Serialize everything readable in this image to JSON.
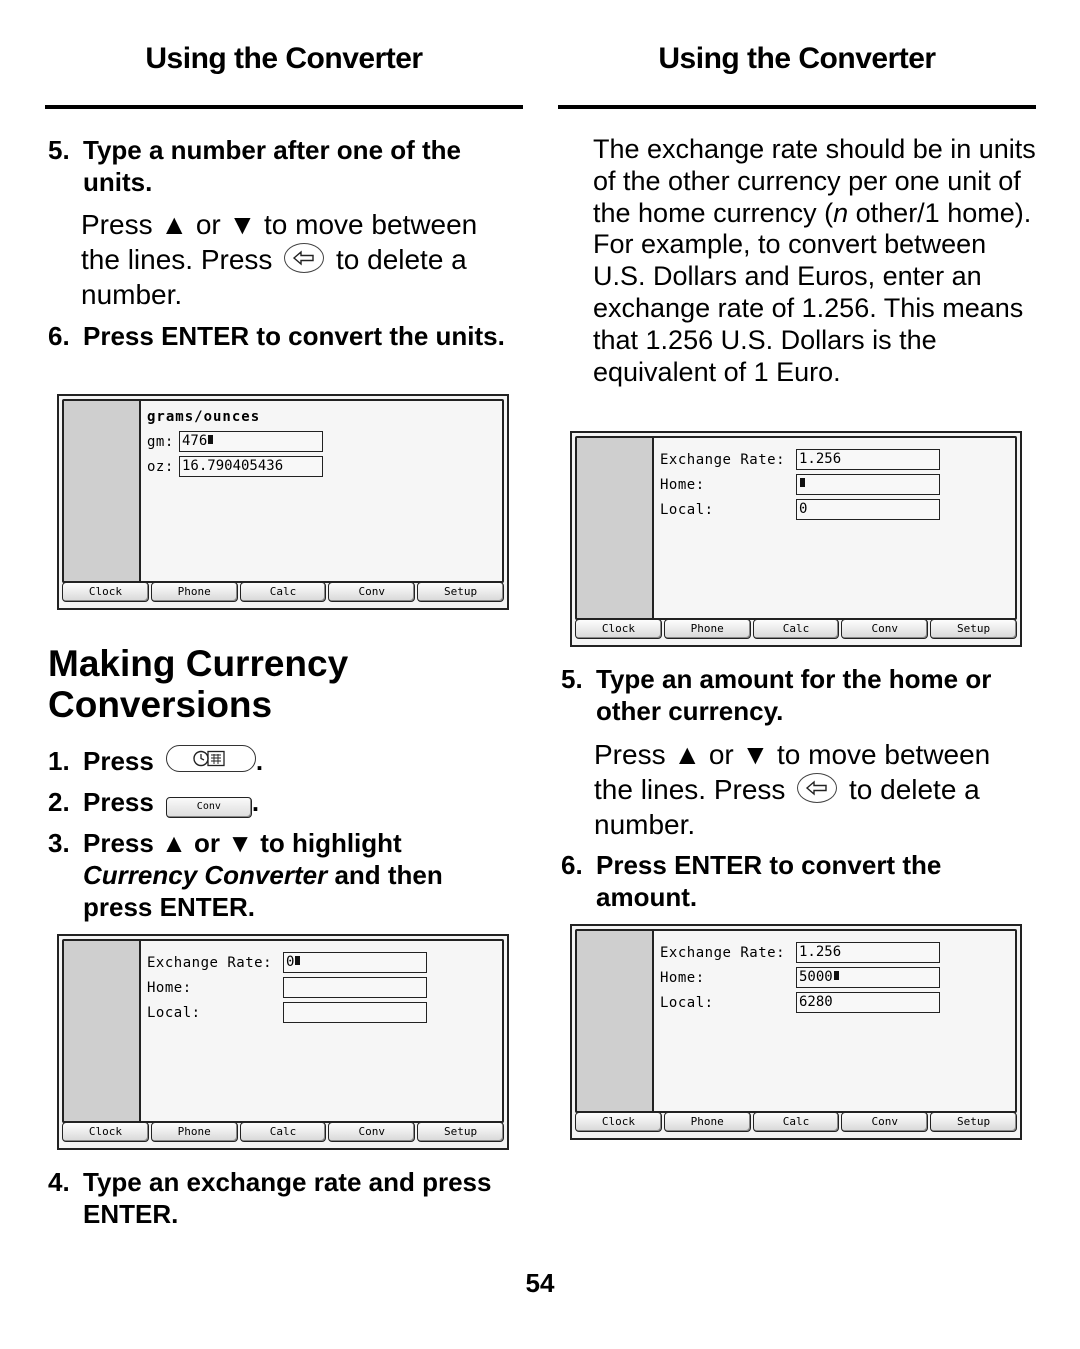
{
  "page": {
    "left_header": "Using the Converter",
    "right_header": "Using the Converter",
    "page_number": "54"
  },
  "left": {
    "step5": {
      "num": "5.",
      "text": "Type a number after one of the units."
    },
    "step5_body": {
      "a": "Press ▲ or ▼ to move between the lines. Press",
      "b": "to delete a number."
    },
    "step6": {
      "num": "6.",
      "text": "Press ENTER to convert the units."
    },
    "section_title": "Making Currency Conversions",
    "step1": {
      "num": "1.",
      "text": "Press",
      "suffix": "."
    },
    "step2": {
      "num": "2.",
      "text": "Press",
      "key_label": "Conv",
      "suffix": "."
    },
    "step3": {
      "num": "3.",
      "text_a": "Press ▲ or ▼ to highlight",
      "italic": "Currency Converter",
      "text_b": "and then press ENTER."
    },
    "step4": {
      "num": "4.",
      "text": "Type an exchange rate and press ENTER."
    }
  },
  "right": {
    "intro": {
      "a": "The exchange rate should be in units of the other currency per one unit of the home currency (",
      "italic": "n",
      "b": " other/1 home). For example, to convert between U.S. Dollars and Euros, enter an exchange rate of 1.256. This means that 1.256 U.S. Dollars is the equivalent of 1 Euro."
    },
    "step5": {
      "num": "5.",
      "text": "Type an amount for the home or other currency."
    },
    "step5_body": {
      "a": "Press ▲ or ▼ to move between the lines. Press",
      "b": "to delete a number."
    },
    "step6": {
      "num": "6.",
      "text": "Press ENTER to convert the amount."
    }
  },
  "tabs": [
    "Clock",
    "Phone",
    "Calc",
    "Conv",
    "Setup"
  ],
  "screens": {
    "units": {
      "title": "grams/ounces",
      "rows": [
        {
          "label": "gm:",
          "value": "476",
          "cursor": true
        },
        {
          "label": "oz:",
          "value": "16.790405436",
          "cursor": false
        }
      ]
    },
    "currency_empty": {
      "rows": [
        {
          "label": "Exchange Rate:",
          "value": "0",
          "cursor": true
        },
        {
          "label": "Home:",
          "value": "",
          "cursor": false
        },
        {
          "label": "Local:",
          "value": "",
          "cursor": false
        }
      ]
    },
    "currency_rate": {
      "rows": [
        {
          "label": "Exchange Rate:",
          "value": "1.256",
          "cursor": false
        },
        {
          "label": "Home:",
          "value": "",
          "cursor": true
        },
        {
          "label": "Local:",
          "value": "0",
          "cursor": false
        }
      ]
    },
    "currency_result": {
      "rows": [
        {
          "label": "Exchange Rate:",
          "value": "1.256",
          "cursor": false
        },
        {
          "label": "Home:",
          "value": "5000",
          "cursor": true
        },
        {
          "label": "Local:",
          "value": "6280",
          "cursor": false
        }
      ]
    }
  }
}
